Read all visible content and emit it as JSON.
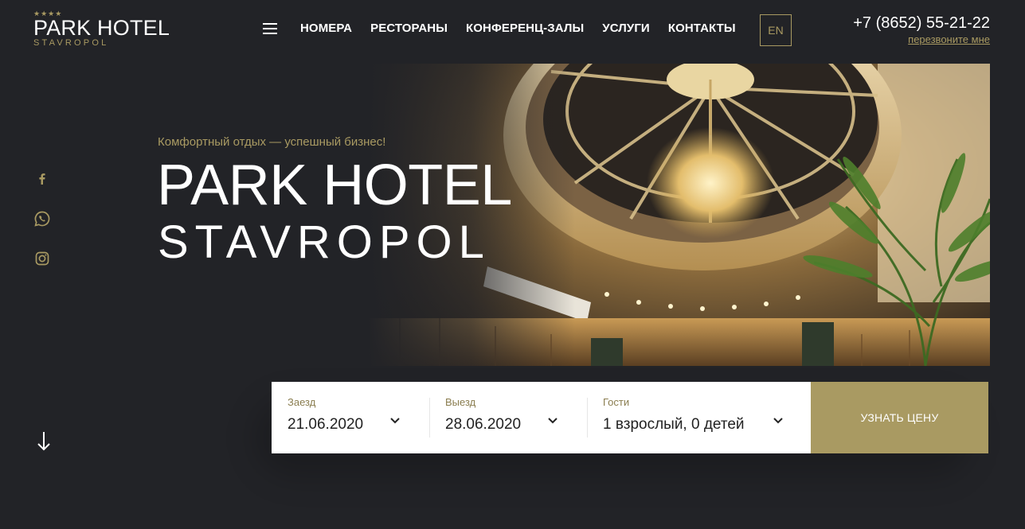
{
  "logo": {
    "stars": "★★★★",
    "title": "PARK HOTEL",
    "subtitle": "STAVROPOL"
  },
  "nav": {
    "menu_icon": "hamburger-icon",
    "items": [
      {
        "label": "НОМЕРА"
      },
      {
        "label": "РЕСТОРАНЫ"
      },
      {
        "label": "КОНФЕРЕНЦ-ЗАЛЫ"
      },
      {
        "label": "УСЛУГИ"
      },
      {
        "label": "КОНТАКТЫ"
      }
    ]
  },
  "lang": {
    "label": "EN"
  },
  "contact": {
    "phone": "+7 (8652) 55-21-22",
    "callback": "перезвоните мне"
  },
  "social": [
    {
      "icon": "facebook-icon"
    },
    {
      "icon": "whatsapp-icon"
    },
    {
      "icon": "instagram-icon"
    }
  ],
  "hero": {
    "tagline": "Комфортный отдых — успешный бизнес!",
    "title": "PARK HOTEL",
    "subtitle": "STAVROPOL",
    "scroll_icon": "arrow-down-icon"
  },
  "booking": {
    "checkin": {
      "label": "Заезд",
      "value": "21.06.2020"
    },
    "checkout": {
      "label": "Выезд",
      "value": "28.06.2020"
    },
    "guests": {
      "label": "Гости",
      "value": "1 взрослый, 0 детей"
    },
    "submit_label": "УЗНАТЬ ЦЕНУ"
  },
  "colors": {
    "background": "#222327",
    "accent": "#a99a62",
    "text": "#ffffff"
  }
}
